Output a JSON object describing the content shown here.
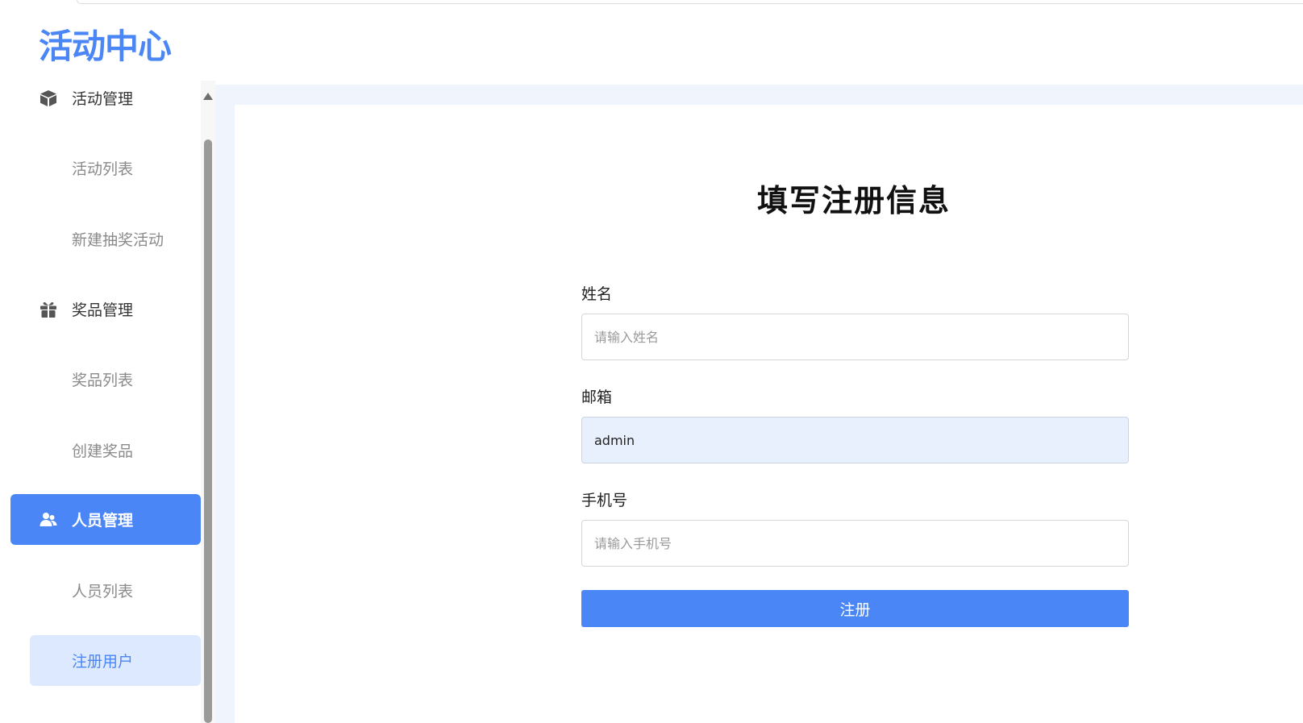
{
  "app": {
    "logo_text": "活动中心"
  },
  "sidebar": {
    "items": [
      {
        "label": "活动管理",
        "kind": "group",
        "icon": "box-icon"
      },
      {
        "label": "活动列表",
        "kind": "sub"
      },
      {
        "label": "新建抽奖活动",
        "kind": "sub"
      },
      {
        "label": "奖品管理",
        "kind": "group",
        "icon": "gift-icon"
      },
      {
        "label": "奖品列表",
        "kind": "sub"
      },
      {
        "label": "创建奖品",
        "kind": "sub"
      },
      {
        "label": "人员管理",
        "kind": "group",
        "icon": "users-icon",
        "active": true
      },
      {
        "label": "人员列表",
        "kind": "sub"
      },
      {
        "label": "注册用户",
        "kind": "sub",
        "active": true
      }
    ]
  },
  "form": {
    "title": "填写注册信息",
    "name": {
      "label": "姓名",
      "placeholder": "请输入姓名",
      "value": ""
    },
    "email": {
      "label": "邮箱",
      "placeholder": "",
      "value": "admin"
    },
    "phone": {
      "label": "手机号",
      "placeholder": "请输入手机号",
      "value": ""
    },
    "submit_label": "注册"
  },
  "colors": {
    "accent": "#4a86f5",
    "active_sub_bg": "#dde9fe",
    "main_bg": "#f0f4fc",
    "autofill_bg": "#e8f0fe"
  }
}
